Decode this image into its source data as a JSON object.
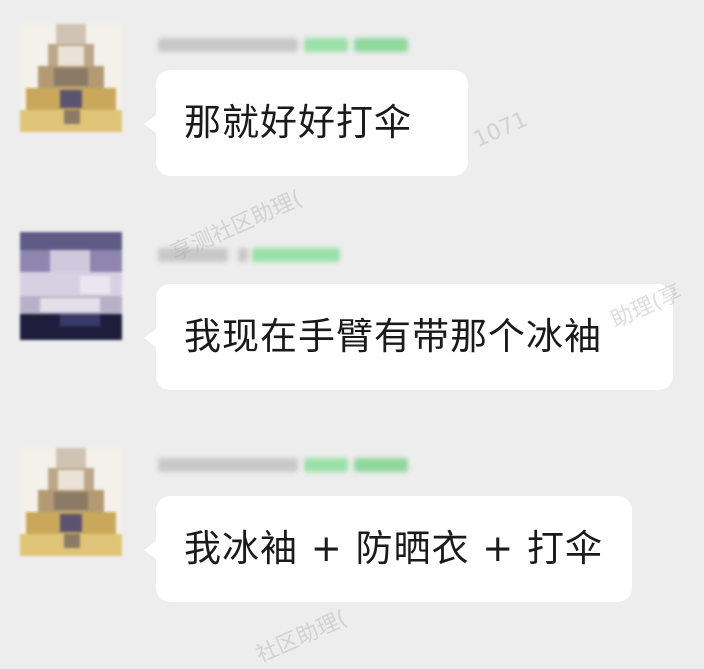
{
  "messages": [
    {
      "id": "msg1",
      "text": "那就好好打伞",
      "avatar": "triangle-avatar",
      "sender_blurred": true
    },
    {
      "id": "msg2",
      "text": "我现在手臂有带那个冰袖",
      "avatar": "landscape-avatar",
      "sender_blurred": true
    },
    {
      "id": "msg3",
      "text": "我冰袖 + 防晒衣 + 打伞",
      "avatar": "triangle-avatar",
      "sender_blurred": true
    }
  ],
  "watermarks": [
    "1071",
    "享测社区助理(",
    "助理(享",
    "社区助理("
  ],
  "colors": {
    "background": "#ededed",
    "bubble": "#ffffff",
    "name_blur": "#c8c8c8",
    "tag_green": "#9be0a8"
  }
}
